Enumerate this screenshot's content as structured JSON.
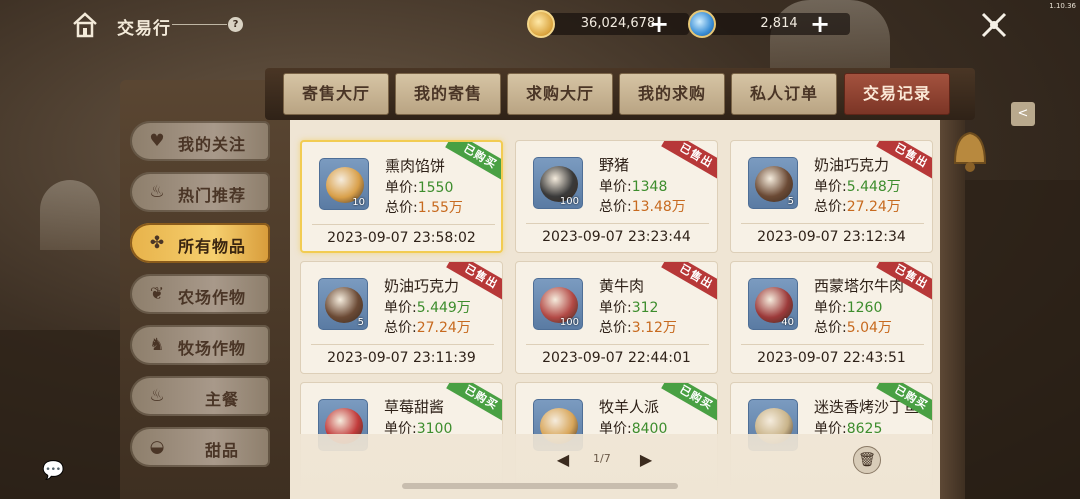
{
  "header": {
    "title": "交易行",
    "help": "?",
    "version": "1.10.36",
    "gold": "36,024,678",
    "gems": "2,814",
    "plus": "+"
  },
  "sidebar": {
    "items": [
      {
        "label": "我的关注",
        "icon": "heart-icon"
      },
      {
        "label": "热门推荐",
        "icon": "fire-icon"
      },
      {
        "label": "所有物品",
        "icon": "grid-icon",
        "active": true
      },
      {
        "label": "农场作物",
        "icon": "leaf-icon"
      },
      {
        "label": "牧场作物",
        "icon": "rooster-icon"
      },
      {
        "label": "主餐",
        "icon": "pot-icon"
      },
      {
        "label": "甜品",
        "icon": "bowl-icon"
      }
    ]
  },
  "tabs": [
    {
      "label": "寄售大厅"
    },
    {
      "label": "我的寄售"
    },
    {
      "label": "求购大厅"
    },
    {
      "label": "我的求购"
    },
    {
      "label": "私人订单"
    },
    {
      "label": "交易记录",
      "active": true
    }
  ],
  "labels": {
    "unit": "单价:",
    "total": "总价:"
  },
  "cards": [
    {
      "name": "熏肉馅饼",
      "qty": "10",
      "unit_price": "1550",
      "total_price": "1.55万",
      "date": "2023-09-07 23:58:02",
      "badge": "已购买",
      "badge_type": "bought",
      "art_color": "#d9a04a"
    },
    {
      "name": "野猪",
      "qty": "100",
      "unit_price": "1348",
      "total_price": "13.48万",
      "date": "2023-09-07 23:23:44",
      "badge": "已售出",
      "badge_type": "sold",
      "art_color": "#3a3a3a"
    },
    {
      "name": "奶油巧克力",
      "qty": "5",
      "unit_price": "5.448万",
      "total_price": "27.24万",
      "date": "2023-09-07 23:12:34",
      "badge": "已售出",
      "badge_type": "sold",
      "art_color": "#6b4a35"
    },
    {
      "name": "奶油巧克力",
      "qty": "5",
      "unit_price": "5.449万",
      "total_price": "27.24万",
      "date": "2023-09-07 23:11:39",
      "badge": "已售出",
      "badge_type": "sold",
      "art_color": "#6b4a35"
    },
    {
      "name": "黄牛肉",
      "qty": "100",
      "unit_price": "312",
      "total_price": "3.12万",
      "date": "2023-09-07 22:44:01",
      "badge": "已售出",
      "badge_type": "sold",
      "art_color": "#b34a46"
    },
    {
      "name": "西蒙塔尔牛肉",
      "qty": "40",
      "unit_price": "1260",
      "total_price": "5.04万",
      "date": "2023-09-07 22:43:51",
      "badge": "已售出",
      "badge_type": "sold",
      "art_color": "#9c3a3a"
    },
    {
      "name": "草莓甜酱",
      "qty": "",
      "unit_price": "3100",
      "total_price": "",
      "date": "",
      "badge": "已购买",
      "badge_type": "bought",
      "art_color": "#c23b3b"
    },
    {
      "name": "牧羊人派",
      "qty": "",
      "unit_price": "8400",
      "total_price": "",
      "date": "",
      "badge": "已购买",
      "badge_type": "bought",
      "art_color": "#d8a65a"
    },
    {
      "name": "迷迭香烤沙丁鱼",
      "qty": "",
      "unit_price": "8625",
      "total_price": "",
      "date": "",
      "badge": "已购买",
      "badge_type": "bought",
      "art_color": "#c9b48a"
    }
  ],
  "pager": {
    "page": "1/7",
    "prev": "◀",
    "next": "▶"
  },
  "colors": {
    "accent_gold": "#f2cc52",
    "sold_red": "#b73838",
    "bought_green": "#49a043",
    "price_green": "#3d8d2d",
    "total_orange": "#c76a1f"
  }
}
